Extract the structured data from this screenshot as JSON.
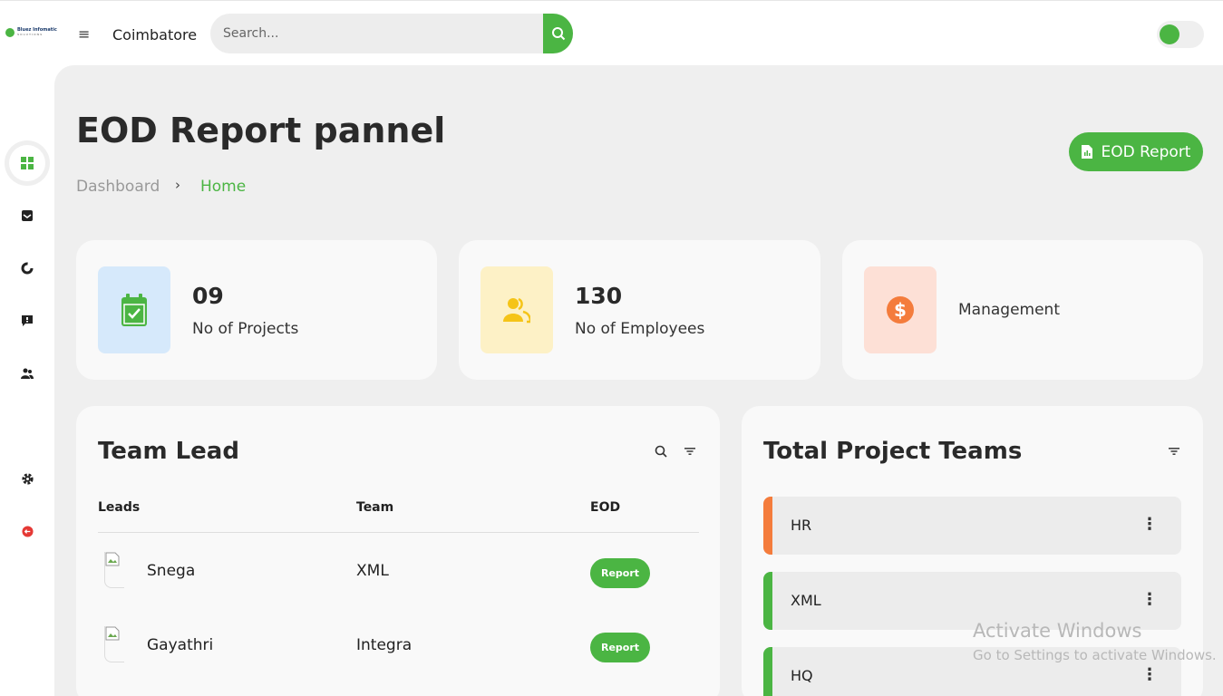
{
  "app": {
    "logo_text": "Bluez Infomatic",
    "logo_sub": "SOLUTIONS"
  },
  "topbar": {
    "location": "Coimbatore",
    "search_placeholder": "Search..."
  },
  "page": {
    "title": "EOD Report pannel",
    "breadcrumb": [
      "Dashboard",
      "Home"
    ],
    "eod_button": "EOD Report"
  },
  "stats": [
    {
      "value": "09",
      "label": "No of Projects",
      "icon": "calendar-check-icon",
      "bg": "#d6e9fb",
      "fg": "#4bb543"
    },
    {
      "value": "130",
      "label": "No of Employees",
      "icon": "users-icon",
      "bg": "#fdf1c6",
      "fg": "#f5c418"
    },
    {
      "value": "",
      "label": "Management",
      "icon": "dollar-coin-icon",
      "bg": "#fde0d6",
      "fg": "#f47c3c"
    }
  ],
  "team_lead": {
    "title": "Team Lead",
    "columns": [
      "Leads",
      "Team",
      "EOD"
    ],
    "rows": [
      {
        "name": "Snega",
        "team": "XML",
        "action": "Report"
      },
      {
        "name": "Gayathri",
        "team": "Integra",
        "action": "Report"
      }
    ]
  },
  "project_teams": {
    "title": "Total Project Teams",
    "items": [
      {
        "name": "HR",
        "color": "#f47c3c"
      },
      {
        "name": "XML",
        "color": "#4bb543"
      },
      {
        "name": "HQ",
        "color": "#4bb543"
      }
    ]
  },
  "watermark": {
    "line1": "Activate Windows",
    "line2": "Go to Settings to activate Windows."
  },
  "colors": {
    "accent": "#4bb543",
    "background": "#efefef",
    "card": "#f9f9f9"
  }
}
